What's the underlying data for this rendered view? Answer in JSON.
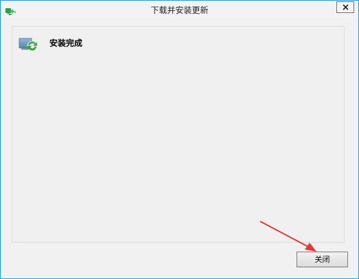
{
  "window": {
    "title": "下载并安装更新",
    "title_icon": "windows-update-icon"
  },
  "content": {
    "status_icon": "update-complete-icon",
    "status_text": "安装完成"
  },
  "footer": {
    "close_button_label": "关闭"
  },
  "colors": {
    "window_border": "#1d9cdb",
    "window_bg": "#f1f1f1",
    "annotation_arrow": "#e53935",
    "icon_green": "#3fb44a"
  }
}
